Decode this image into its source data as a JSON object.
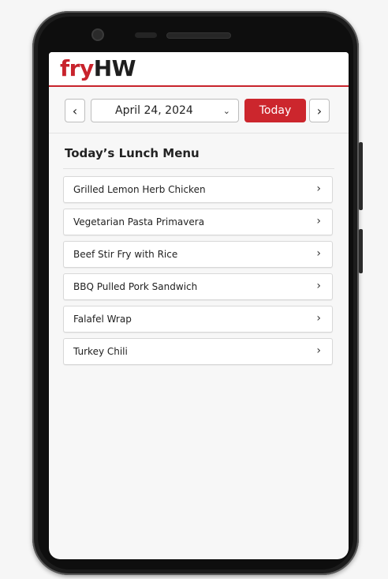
{
  "app": {
    "logo_part1": "fry",
    "logo_part2": "HW"
  },
  "date_bar": {
    "prev_icon": "‹",
    "next_icon": "›",
    "selected_date": "April 24, 2024",
    "dropdown_icon": "⌄",
    "today_label": "Today"
  },
  "menu": {
    "title": "Today’s Lunch Menu",
    "items": [
      {
        "label": "Grilled Lemon Herb Chicken"
      },
      {
        "label": "Vegetarian Pasta Primavera"
      },
      {
        "label": "Beef Stir Fry with Rice"
      },
      {
        "label": "BBQ Pulled Pork Sandwich"
      },
      {
        "label": "Falafel Wrap"
      },
      {
        "label": "Turkey Chili"
      }
    ],
    "item_arrow": "›"
  },
  "colors": {
    "brand_red": "#cc262d",
    "text_dark": "#222222"
  }
}
